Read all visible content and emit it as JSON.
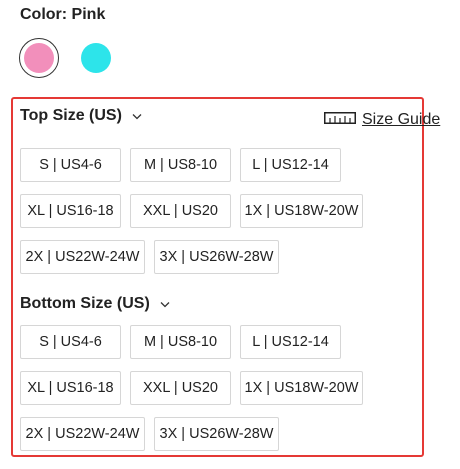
{
  "color": {
    "title": "Color: Pink",
    "swatches": [
      {
        "name": "Pink",
        "hex": "#f28fbb",
        "selected": true
      },
      {
        "name": "Cyan",
        "hex": "#2de4ea",
        "selected": false
      }
    ]
  },
  "top_size": {
    "title": "Top Size (US)",
    "options": [
      "S | US4-6",
      "M | US8-10",
      "L | US12-14",
      "XL | US16-18",
      "XXL | US20",
      "1X | US18W-20W",
      "2X | US22W-24W",
      "3X | US26W-28W"
    ]
  },
  "size_guide": {
    "label": "Size Guide",
    "icon": "ruler-icon"
  },
  "bottom_size": {
    "title": "Bottom Size (US)",
    "options": [
      "S | US4-6",
      "M | US8-10",
      "L | US12-14",
      "XL | US16-18",
      "XXL | US20",
      "1X | US18W-20W",
      "2X | US22W-24W",
      "3X | US26W-28W"
    ]
  },
  "colors": {
    "highlight_border": "#e53935",
    "button_border": "#d6d6d6",
    "text": "#222222"
  }
}
